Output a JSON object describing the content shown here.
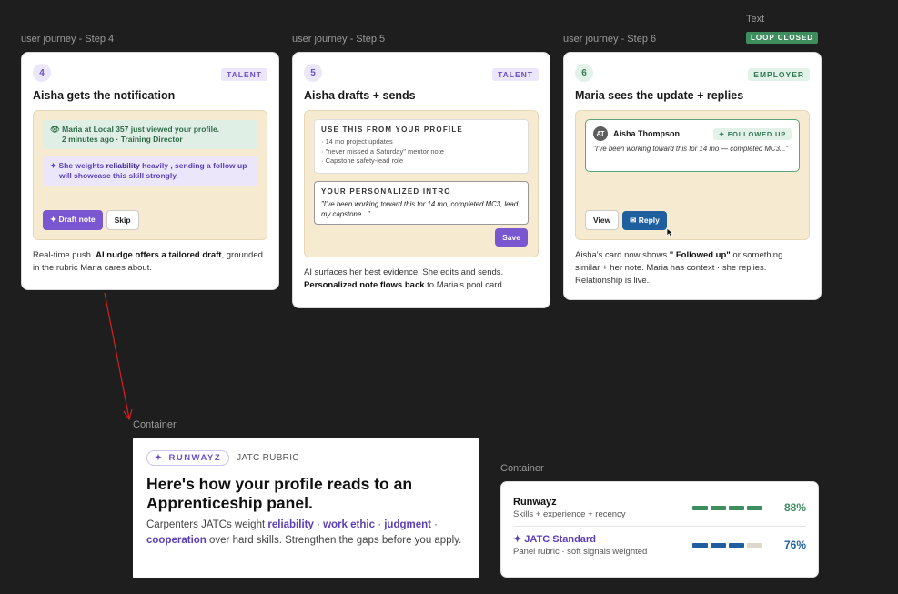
{
  "labels": {
    "step4": "user journey - Step 4",
    "step5": "user journey - Step 5",
    "step6": "user journey - Step 6",
    "text": "Text",
    "container1": "Container",
    "container2": "Container"
  },
  "loop_badge": "LOOP CLOSED",
  "colors": {
    "talent": "#7a57d1",
    "employer": "#3e8d5f",
    "reply": "#1f5fa0",
    "arrow": "#d62020"
  },
  "card4": {
    "num": "4",
    "tag": "TALENT",
    "title": "Aisha gets the notification",
    "notif1": "Maria at Local 357 just viewed your profile.",
    "notif1_sub": "2 minutes ago · Training Director",
    "notif2_a": "She weights ",
    "notif2_b": "reliability",
    "notif2_c": " heavily , sending a follow up will showcase this skill strongly.",
    "btn_draft": "✦ Draft note",
    "btn_skip": "Skip",
    "cap_a": "Real-time push. ",
    "cap_b": "AI nudge offers a tailored draft",
    "cap_c": ", grounded in the rubric Maria cares about."
  },
  "card5": {
    "num": "5",
    "tag": "TALENT",
    "title": "Aisha drafts + sends",
    "box1_head": "USE THIS FROM YOUR PROFILE",
    "box1_items": [
      "· 14 mo project updates",
      "· \"never missed a Saturday\" mentor note",
      "· Capstone safety-lead role"
    ],
    "box2_head": "YOUR PERSONALIZED INTRO",
    "box2_text": "\"I've been working toward this for 14 mo, completed MC3, lead my capstone...\"",
    "btn_save": "Save",
    "cap_a": "AI surfaces her best evidence. She edits and sends. ",
    "cap_b": "Personalized note flows back",
    "cap_c": " to Maria's pool card."
  },
  "card6": {
    "num": "6",
    "tag": "EMPLOYER",
    "title": "Maria sees the update + replies",
    "avatar": "AT",
    "name": "Aisha Thompson",
    "followed": "✦ FOLLOWED UP",
    "quote": "\"I've been working toward this for 14 mo — completed MC3...\"",
    "btn_view": "View",
    "btn_reply": "Reply",
    "cap_a": "Aisha's card now shows ",
    "cap_b": "\" Followed up\"",
    "cap_c": " or something similar + her note. Maria has context · she replies. Relationship is live."
  },
  "rubric": {
    "brand": "RUNWAYZ",
    "sub": "JATC RUBRIC",
    "title": "Here's how your profile reads to an Apprenticeship panel.",
    "body_a": "Carpenters JATCs weight ",
    "hl1": "reliability",
    "sep1": " · ",
    "hl2": "work ethic",
    "sep2": " · ",
    "hl3": "judgment",
    "sep3": " · ",
    "hl4": "cooperation",
    "body_b": " over hard skills. Strengthen the gaps before you apply."
  },
  "scores": [
    {
      "name": "Runwayz",
      "desc": "Skills + experience + recency",
      "value": "88%",
      "fill_segments": 4,
      "total_segments": 4,
      "color": "#3e8d5f"
    },
    {
      "name": "✦ JATC Standard",
      "desc": "Panel rubric · soft signals weighted",
      "value": "76%",
      "fill_segments": 3,
      "total_segments": 4,
      "color": "#1f5fa0"
    }
  ]
}
